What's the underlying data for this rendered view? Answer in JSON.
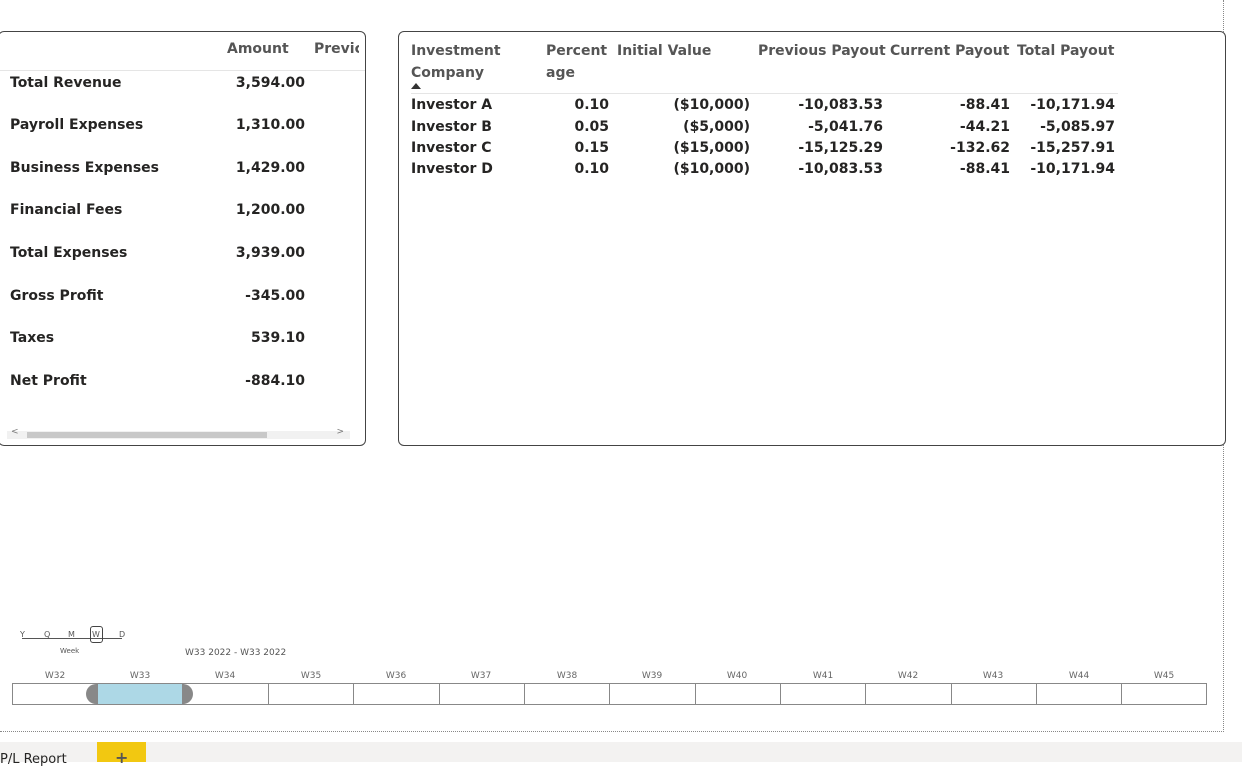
{
  "pl_matrix": {
    "columns": {
      "amount": "Amount",
      "previous": "Previc"
    },
    "rows": [
      {
        "label": "Total Revenue",
        "amount": "3,594.00"
      },
      {
        "label": "Payroll Expenses",
        "amount": "1,310.00"
      },
      {
        "label": "Business Expenses",
        "amount": "1,429.00"
      },
      {
        "label": "Financial Fees",
        "amount": "1,200.00"
      },
      {
        "label": "Total Expenses",
        "amount": "3,939.00"
      },
      {
        "label": "Gross Profit",
        "amount": "-345.00"
      },
      {
        "label": "Taxes",
        "amount": "539.10"
      },
      {
        "label": "Net Profit",
        "amount": "-884.10"
      }
    ],
    "scroll_left": "<",
    "scroll_right": ">"
  },
  "investor_table": {
    "headers": {
      "company_line1": "Investment",
      "company_line2": "Company",
      "percent_line1": "Percent",
      "percent_line2": "age",
      "initial": "Initial Value",
      "previous": "Previous Payout",
      "current": "Current Payout",
      "total": "Total Payout"
    },
    "rows": [
      {
        "company": "Investor A",
        "percent": "0.10",
        "initial": "($10,000)",
        "previous": "-10,083.53",
        "current": "-88.41",
        "total": "-10,171.94"
      },
      {
        "company": "Investor B",
        "percent": "0.05",
        "initial": "($5,000)",
        "previous": "-5,041.76",
        "current": "-44.21",
        "total": "-5,085.97"
      },
      {
        "company": "Investor C",
        "percent": "0.15",
        "initial": "($15,000)",
        "previous": "-15,125.29",
        "current": "-132.62",
        "total": "-15,257.91"
      },
      {
        "company": "Investor D",
        "percent": "0.10",
        "initial": "($10,000)",
        "previous": "-10,083.53",
        "current": "-88.41",
        "total": "-10,171.94"
      }
    ]
  },
  "timeline": {
    "granularity": [
      "Y",
      "Q",
      "M",
      "W",
      "D"
    ],
    "selected_granularity": "W",
    "granularity_label": "Week",
    "range_label": "W33 2022 - W33 2022",
    "weeks": [
      "W32",
      "W33",
      "W34",
      "W35",
      "W36",
      "W37",
      "W38",
      "W39",
      "W40",
      "W41",
      "W42",
      "W43",
      "W44",
      "W45"
    ]
  },
  "pages": {
    "current_tab": "P/L Report",
    "add_label": "+"
  }
}
